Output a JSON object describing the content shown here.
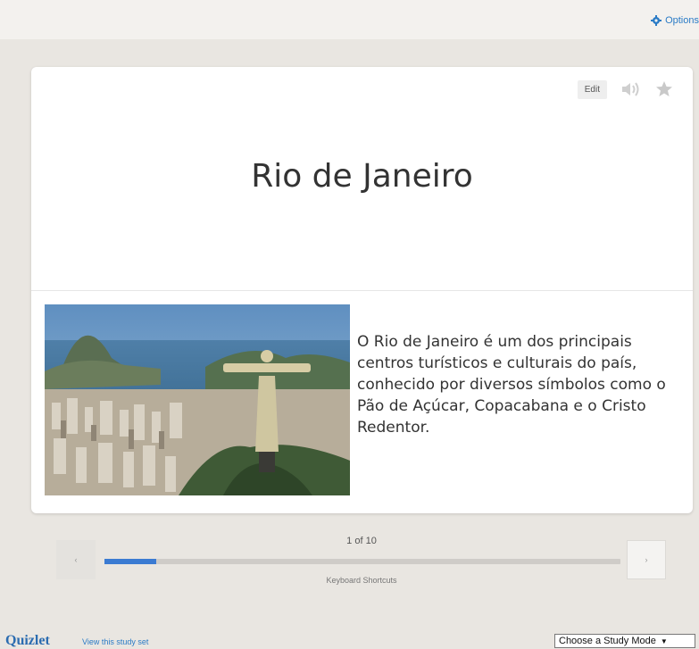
{
  "header": {
    "options_label": "Options",
    "options_icon": "gear-icon"
  },
  "card": {
    "edit_label": "Edit",
    "audio_icon": "speaker-icon",
    "star_icon": "star-icon",
    "term": "Rio de Janeiro",
    "image_description_icon": "rio-christ-redeemer-photo",
    "definition": "O Rio de Janeiro é um dos principais centros turísticos e culturais do país, conhecido por diversos símbolos como o Pão de Açúcar, Copacabana e o Cristo Redentor."
  },
  "controls": {
    "prev_icon": "‹",
    "next_icon": "›",
    "progress_text": "1 of 10",
    "progress_current": 1,
    "progress_total": 10,
    "shortcuts_label": "Keyboard Shortcuts"
  },
  "footer": {
    "logo": "Quizlet",
    "view_link": "View this study set",
    "study_mode_label": "Choose a Study Mode"
  },
  "colors": {
    "accent": "#3b7bd2",
    "link": "#2a7bc6",
    "background": "#e9e6e1"
  }
}
